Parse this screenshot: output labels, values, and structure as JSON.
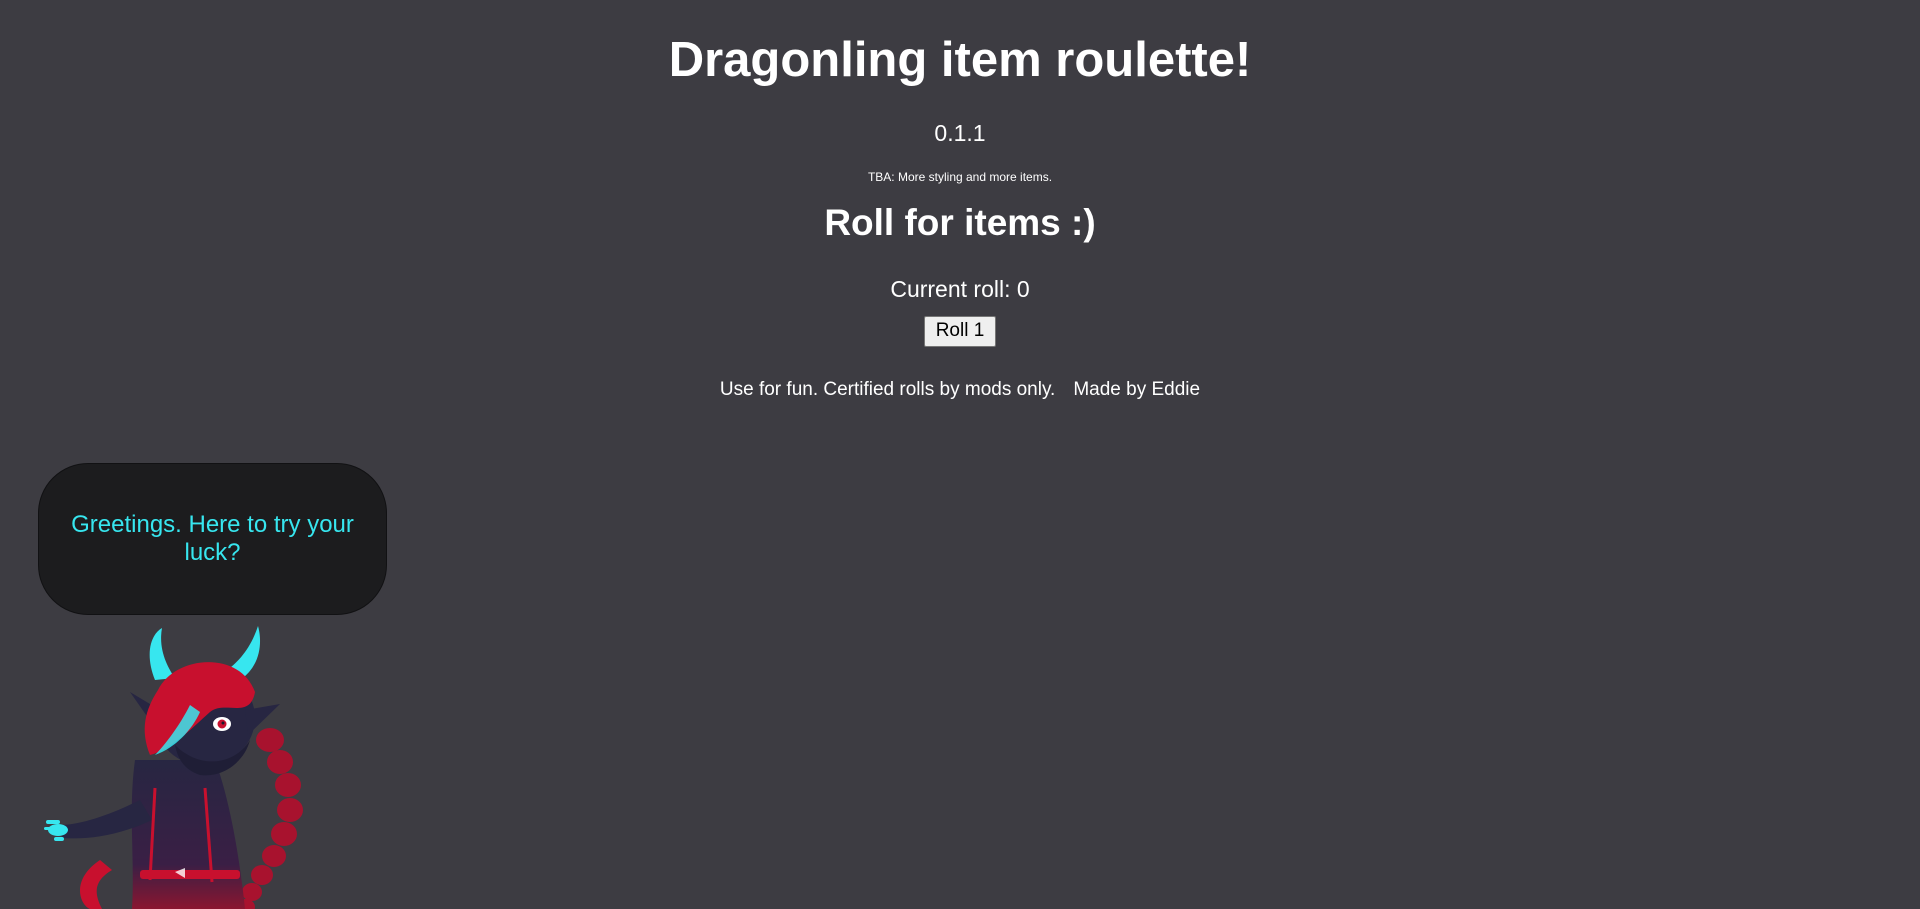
{
  "header": {
    "title": "Dragonling item roulette!",
    "version": "0.1.1",
    "tba_note": "TBA: More styling and more items."
  },
  "roller": {
    "heading": "Roll for items :)",
    "current_roll_label": "Current roll: 0",
    "roll_button_label": "Roll 1"
  },
  "footer": {
    "disclaimer": "Use for fun. Certified rolls by mods only.",
    "credit": "Made by Eddie"
  },
  "mascot": {
    "speech": "Greetings. Here to try your luck?"
  },
  "colors": {
    "background": "#3d3c42",
    "bubble_background": "#1c1c1e",
    "speech_text": "#37e6ef",
    "accent_red": "#c8102e",
    "mascot_body": "#272642"
  }
}
